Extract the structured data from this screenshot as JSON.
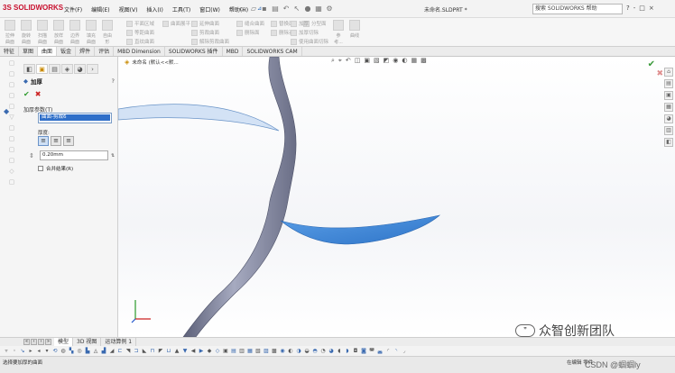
{
  "app": {
    "logo": "SOLIDWORKS",
    "menu": [
      "文件(F)",
      "编辑(E)",
      "视图(V)",
      "插入(I)",
      "工具(T)",
      "窗口(W)",
      "帮助(H)"
    ],
    "document_title": "未命名.SLDPRT *",
    "search_placeholder": "搜索 SOLIDWORKS 帮助",
    "window_buttons": [
      "?",
      "-",
      "□",
      "×"
    ]
  },
  "ribbon": {
    "big_buttons": [
      "拉伸曲面",
      "旋转曲面",
      "扫描曲面",
      "放样曲面",
      "边界曲面",
      "填充曲面",
      "自由形"
    ],
    "small_col1": [
      "平面区域",
      "等距曲面",
      "直纹曲面"
    ],
    "small_col2": [
      "曲面展平"
    ],
    "small_col3": [
      "延伸曲面",
      "剪裁曲面",
      "解除剪裁曲面"
    ],
    "small_col4": [
      "缝合曲面",
      "删除面"
    ],
    "small_col5": [
      "替换面",
      "删除孔"
    ],
    "small_col6": [
      "分型面"
    ],
    "small_col7": [
      "加厚",
      "加厚切除",
      "使用曲面切除"
    ],
    "misc_buttons": [
      "参考...",
      "曲线"
    ]
  },
  "command_tabs": [
    "特征",
    "草图",
    "曲面",
    "钣金",
    "焊件",
    "评估",
    "MBD Dimension",
    "SOLIDWORKS 插件",
    "MBD",
    "SOLIDWORKS CAM"
  ],
  "active_tab_index": 2,
  "property_manager": {
    "title": "加厚",
    "help": "?",
    "section_title": "加厚参数(T)",
    "selection": "曲面-剪裁6",
    "direction_label": "厚度:",
    "thickness_value": "0.20mm",
    "merge_label": "合并结果(R)"
  },
  "viewport": {
    "tree_label": "未命名  (默认<<默..."
  },
  "bottom_tabs": [
    "模型",
    "3D 视图",
    "运动算例 1"
  ],
  "active_bottom_tab_index": 0,
  "status": {
    "left": "选择要加厚的曲面",
    "right": "在编辑 零件"
  },
  "watermark": {
    "text": "众智创新团队",
    "csdn": "CSDN @蝈蝈ly"
  },
  "colors": {
    "selection_blue": "#2f6fc9",
    "surface_blue": "#4a90d9",
    "tube_gray": "#8b8fa8",
    "logo_red": "#c8102e"
  }
}
